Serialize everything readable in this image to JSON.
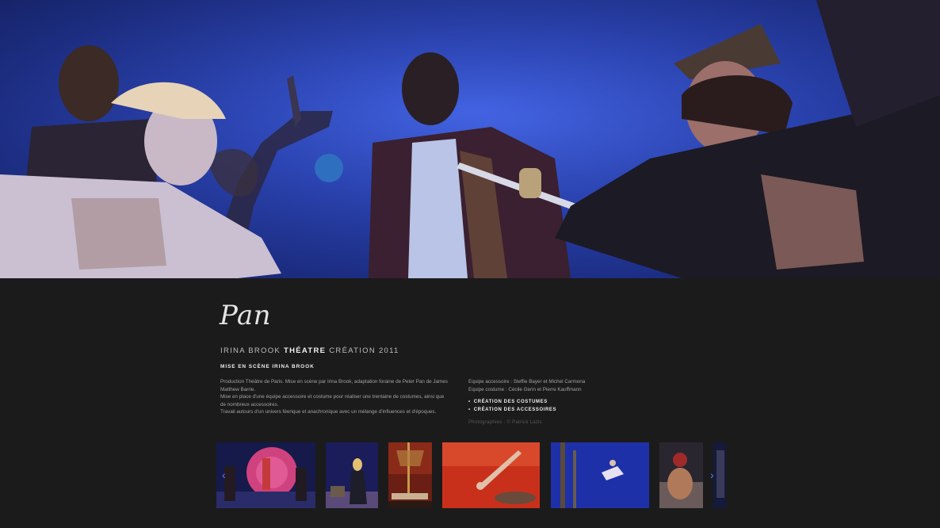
{
  "show": {
    "title": "Pan",
    "director": "IRINA BROOK",
    "category": "THÉATRE",
    "creation": "CRÉATION 2011",
    "staging": "MISE EN SCÈNE IRINA BROOK",
    "description": [
      "Production Théâtre de Paris. Mise en scène par Irina Brook, adaptation foraine de Peter Pan de James Matthew Barrie.",
      "Mise en place d'une équipe accessoire et costume pour réaliser une trentaine de costumes, ainsi que de nombreux accessoires.",
      "Travail autours d'un univers féerique et anachronique avec un mélange d'influences et d'époques."
    ],
    "team": [
      "Equipe accessoire : Steffie Bayer et Michel Carmona",
      "Equipe costume : Cécile Gerin et Pierre Kauffmann"
    ],
    "links": [
      "CRÉATION DES COSTUMES",
      "CRÉATION DES ACCESSOIRES"
    ],
    "credit": "Photographies : © Patrick Lazic"
  },
  "gallery": {
    "prev_icon": "chevron-left-icon",
    "next_icon": "chevron-right-icon",
    "prev_glyph": "‹",
    "next_glyph": "›"
  }
}
